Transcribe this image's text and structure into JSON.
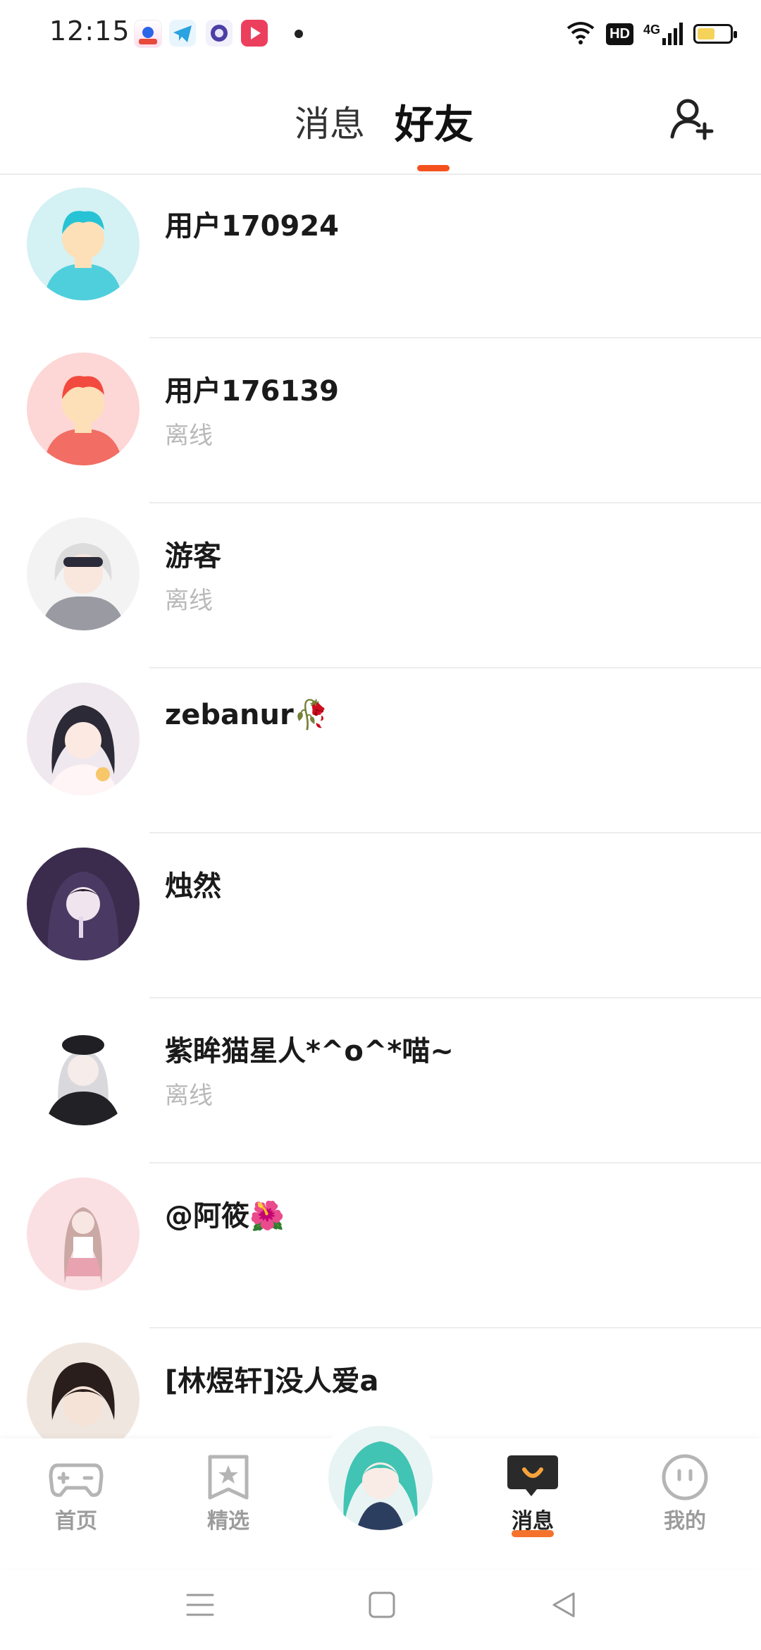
{
  "status_bar": {
    "time": "12:15",
    "hd": "HD",
    "network": "4G",
    "battery_level": 0.55
  },
  "top_nav": {
    "tab_messages": "消息",
    "tab_friends": "好友",
    "active_tab": "好友",
    "add_friend_icon": "add-user-icon"
  },
  "friends": [
    {
      "name": "用户170924",
      "status": ""
    },
    {
      "name": "用户176139",
      "status": "离线"
    },
    {
      "name": "游客",
      "status": "离线"
    },
    {
      "name": "zebanur🥀",
      "status": ""
    },
    {
      "name": "烛然",
      "status": ""
    },
    {
      "name": "紫眸猫星人*^o^*喵~",
      "status": "离线"
    },
    {
      "name": "@阿筱🌺",
      "status": ""
    },
    {
      "name": "[林煜轩]没人爱a",
      "status": ""
    }
  ],
  "bottom_nav": {
    "home": "首页",
    "featured": "精选",
    "messages": "消息",
    "mine": "我的",
    "active": "消息"
  },
  "colors": {
    "accent": "#f4511e",
    "secondary_text": "#b9b9b9"
  }
}
